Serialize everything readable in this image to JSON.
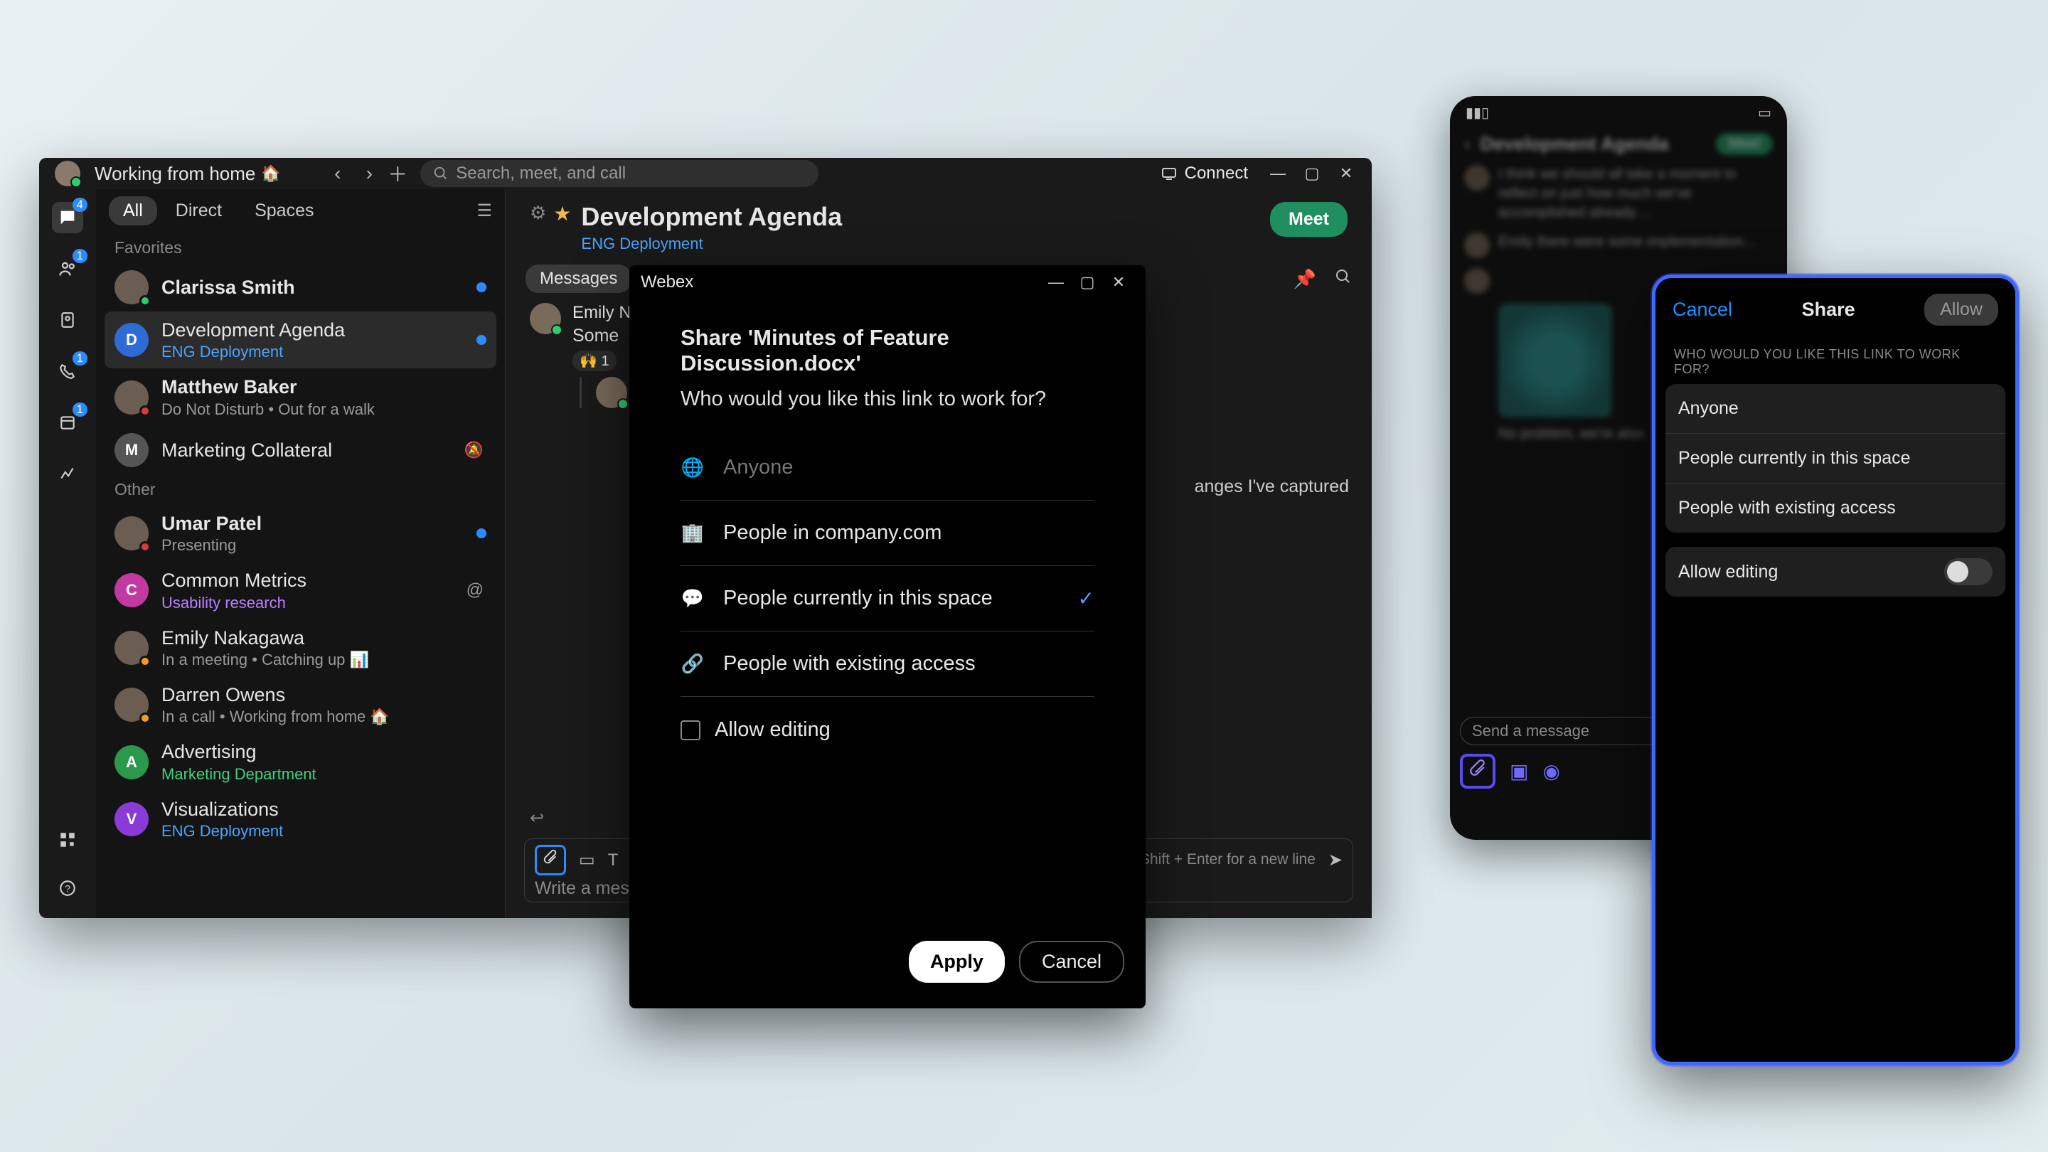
{
  "desktop": {
    "status_text": "Working from home",
    "status_emoji": "🏠",
    "search_placeholder": "Search, meet, and call",
    "connect_label": "Connect",
    "rail": {
      "badges": {
        "chat": "4",
        "team": "1",
        "call": "1",
        "cal": "1"
      }
    },
    "tabs": {
      "all": "All",
      "direct": "Direct",
      "spaces": "Spaces"
    },
    "sections": {
      "favorites": "Favorites",
      "other": "Other"
    },
    "favorites": [
      {
        "name": "Clarissa Smith",
        "sub": "",
        "bold": true,
        "unread": true,
        "avatar": "person",
        "presence": "#2ecc71"
      },
      {
        "name": "Development Agenda",
        "sub": "ENG Deployment",
        "sub_style": "blue",
        "initial": "D",
        "bg": "#2e6bd6",
        "unread": true,
        "active": true
      },
      {
        "name": "Matthew Baker",
        "sub": "Do Not Disturb  •  Out for a walk",
        "bold": true,
        "avatar": "person",
        "presence": "#d93a3a"
      },
      {
        "name": "Marketing Collateral",
        "sub": "",
        "initial": "M",
        "bg": "#555",
        "muted": true
      }
    ],
    "other": [
      {
        "name": "Umar Patel",
        "sub": "Presenting",
        "bold": true,
        "avatar": "person",
        "presence": "#d93a3a",
        "unread": true
      },
      {
        "name": "Common Metrics",
        "sub": "Usability research",
        "sub_style": "purple",
        "initial": "C",
        "bg": "#c23aa0",
        "mention": true
      },
      {
        "name": "Emily Nakagawa",
        "sub": "In a meeting  •  Catching up 📊",
        "avatar": "person",
        "presence": "#f29b2b"
      },
      {
        "name": "Darren Owens",
        "sub": "In a call  •  Working from home 🏠",
        "avatar": "person",
        "presence": "#f29b2b"
      },
      {
        "name": "Advertising",
        "sub": "Marketing Department",
        "sub_style": "green",
        "initial": "A",
        "bg": "#2a9a4a"
      },
      {
        "name": "Visualizations",
        "sub": "ENG Deployment",
        "sub_style": "blue",
        "initial": "V",
        "bg": "#8a3ad6"
      }
    ]
  },
  "conversation": {
    "title": "Development Agenda",
    "team": "ENG Deployment",
    "meet": "Meet",
    "tab_messages": "Messages",
    "sender": "Emily N",
    "body": "Some",
    "reaction": "🙌 1",
    "peek_text": "anges I've captured",
    "composer": {
      "placeholder": "Write a mes",
      "hint": "Shift + Enter for a new line"
    }
  },
  "dialog": {
    "app": "Webex",
    "heading": "Share 'Minutes of Feature Discussion.docx'",
    "who": "Who would you like this link to work for?",
    "options": [
      {
        "icon": "globe",
        "label": "Anyone",
        "dim": true
      },
      {
        "icon": "building",
        "label": "People in company.com"
      },
      {
        "icon": "chat",
        "label": "People currently in this space",
        "selected": true
      },
      {
        "icon": "link",
        "label": "People with existing access"
      }
    ],
    "allow_editing": "Allow editing",
    "apply": "Apply",
    "cancel": "Cancel"
  },
  "phone": {
    "title": "Development Agenda",
    "meet": "Meet",
    "compose_placeholder": "Send a message"
  },
  "sheet": {
    "cancel": "Cancel",
    "title": "Share",
    "allow": "Allow",
    "subhead": "Who would you like this link to work for?",
    "options": [
      "Anyone",
      "People currently in this space",
      "People with existing access"
    ],
    "allow_editing": "Allow editing"
  }
}
